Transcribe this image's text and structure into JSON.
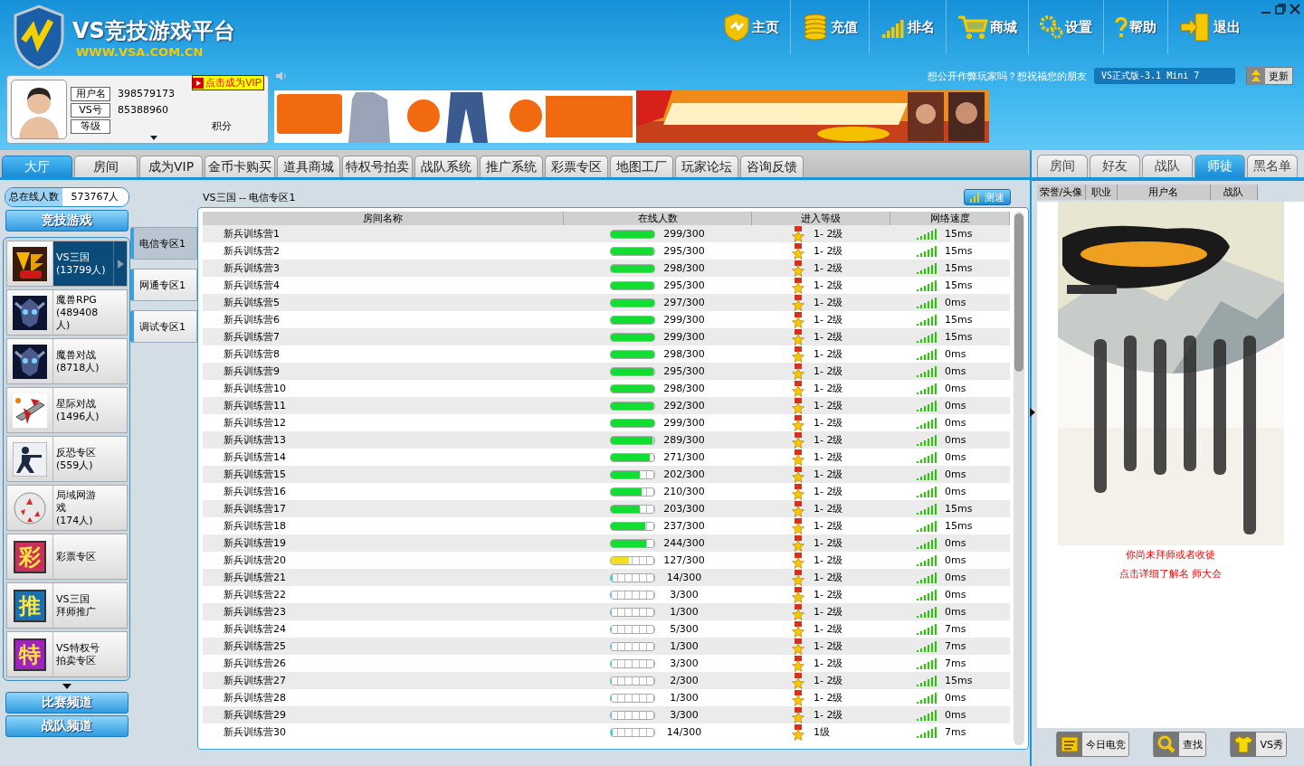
{
  "logo": {
    "title": "VS竞技游戏平台",
    "url": "WWW.VSA.COM.CN"
  },
  "nav": [
    {
      "kind": "home",
      "label": "主页"
    },
    {
      "kind": "coins",
      "label": "充值"
    },
    {
      "kind": "rank",
      "label": "排名"
    },
    {
      "kind": "cart",
      "label": "商城"
    },
    {
      "kind": "gear",
      "label": "设置"
    },
    {
      "kind": "help",
      "label": "帮助"
    },
    {
      "kind": "exit",
      "label": "退出"
    }
  ],
  "user": {
    "fields": [
      {
        "label": "用户名",
        "value": "398579173"
      },
      {
        "label": "VS号",
        "value": "85388960"
      },
      {
        "label": "等级"
      }
    ],
    "score_label": "积分",
    "vip_button": "点击成为VIP"
  },
  "notice": "想公开作弊玩家吗？想祝福您的朋友",
  "version": "VS正式版-3.1  Mini 7",
  "update_button": "更新",
  "main_tabs": [
    {
      "label": "大厅",
      "selected": true
    },
    {
      "label": "房间",
      "selected": false
    },
    {
      "label": "成为VIP",
      "selected": false
    },
    {
      "label": "金币卡购买",
      "selected": false
    },
    {
      "label": "道具商城",
      "selected": false
    },
    {
      "label": "特权号拍卖",
      "selected": false
    },
    {
      "label": "战队系统",
      "selected": false
    },
    {
      "label": "推广系统",
      "selected": false
    },
    {
      "label": "彩票专区",
      "selected": false
    },
    {
      "label": "地图工厂",
      "selected": false
    },
    {
      "label": "玩家论坛",
      "selected": false
    },
    {
      "label": "咨询反馈",
      "selected": false
    }
  ],
  "online": {
    "label": "总在线人数",
    "value": "573767人"
  },
  "games_header": "竞技游戏",
  "games": [
    {
      "kind": "vs",
      "lines": [
        "VS三国",
        "(13799人)"
      ],
      "selected": true
    },
    {
      "kind": "warcraft",
      "lines": [
        "魔兽RPG",
        "(489408",
        "人)"
      ],
      "selected": false
    },
    {
      "kind": "warcraft",
      "lines": [
        "魔兽对战",
        "(8718人)"
      ],
      "selected": false
    },
    {
      "kind": "starcraft",
      "lines": [
        "星际对战",
        "(1496人)"
      ],
      "selected": false
    },
    {
      "kind": "soldier",
      "lines": [
        "反恐专区",
        "(559人)"
      ],
      "selected": false
    },
    {
      "kind": "ball",
      "lines": [
        "局域网游",
        "戏",
        "(174人)"
      ],
      "selected": false
    },
    {
      "kind": "glyph",
      "icon_text": "彩",
      "color": "#c8305a",
      "lines": [
        "彩票专区"
      ],
      "selected": false
    },
    {
      "kind": "glyph",
      "icon_text": "推",
      "color": "#1a6fb0",
      "lines": [
        "VS三国",
        "拜师推广"
      ],
      "selected": false
    },
    {
      "kind": "glyph",
      "icon_text": "特",
      "color": "#a020c0",
      "lines": [
        "VS特权号",
        "拍卖专区"
      ],
      "selected": false
    }
  ],
  "channels": [
    "比赛频道",
    "战队频道"
  ],
  "zones": [
    {
      "label": "电信专区1",
      "selected": true
    },
    {
      "label": "网通专区1",
      "selected": false
    },
    {
      "label": "调试专区1",
      "selected": false
    }
  ],
  "breadcrumb": "VS三国 -- 电信专区1",
  "speed_test_button": "测速",
  "table": {
    "columns": [
      "房间名称",
      "在线人数",
      "进入等级",
      "网络速度"
    ],
    "rows": [
      {
        "name": "新兵训练营1",
        "count": "299/300",
        "level": 0.997,
        "range": "1- 2级",
        "speed": "15ms"
      },
      {
        "name": "新兵训练营2",
        "count": "295/300",
        "level": 0.983,
        "range": "1- 2级",
        "speed": "15ms"
      },
      {
        "name": "新兵训练营3",
        "count": "298/300",
        "level": 0.993,
        "range": "1- 2级",
        "speed": "15ms"
      },
      {
        "name": "新兵训练营4",
        "count": "295/300",
        "level": 0.983,
        "range": "1- 2级",
        "speed": "15ms"
      },
      {
        "name": "新兵训练营5",
        "count": "297/300",
        "level": 0.99,
        "range": "1- 2级",
        "speed": "0ms"
      },
      {
        "name": "新兵训练营6",
        "count": "299/300",
        "level": 0.997,
        "range": "1- 2级",
        "speed": "15ms"
      },
      {
        "name": "新兵训练营7",
        "count": "299/300",
        "level": 0.997,
        "range": "1- 2级",
        "speed": "15ms"
      },
      {
        "name": "新兵训练营8",
        "count": "298/300",
        "level": 0.993,
        "range": "1- 2级",
        "speed": "0ms"
      },
      {
        "name": "新兵训练营9",
        "count": "295/300",
        "level": 0.983,
        "range": "1- 2级",
        "speed": "0ms"
      },
      {
        "name": "新兵训练营10",
        "count": "298/300",
        "level": 0.993,
        "range": "1- 2级",
        "speed": "0ms"
      },
      {
        "name": "新兵训练营11",
        "count": "292/300",
        "level": 0.973,
        "range": "1- 2级",
        "speed": "0ms"
      },
      {
        "name": "新兵训练营12",
        "count": "299/300",
        "level": 0.997,
        "range": "1- 2级",
        "speed": "0ms"
      },
      {
        "name": "新兵训练营13",
        "count": "289/300",
        "level": 0.963,
        "range": "1- 2级",
        "speed": "0ms"
      },
      {
        "name": "新兵训练营14",
        "count": "271/300",
        "level": 0.903,
        "range": "1- 2级",
        "speed": "0ms"
      },
      {
        "name": "新兵训练营15",
        "count": "202/300",
        "level": 0.673,
        "range": "1- 2级",
        "speed": "0ms"
      },
      {
        "name": "新兵训练营16",
        "count": "210/300",
        "level": 0.7,
        "range": "1- 2级",
        "speed": "0ms"
      },
      {
        "name": "新兵训练营17",
        "count": "203/300",
        "level": 0.677,
        "range": "1- 2级",
        "speed": "15ms"
      },
      {
        "name": "新兵训练营18",
        "count": "237/300",
        "level": 0.79,
        "range": "1- 2级",
        "speed": "15ms"
      },
      {
        "name": "新兵训练营19",
        "count": "244/300",
        "level": 0.813,
        "range": "1- 2级",
        "speed": "0ms"
      },
      {
        "name": "新兵训练营20",
        "count": "127/300",
        "level": 0.423,
        "range": "1- 2级",
        "speed": "0ms"
      },
      {
        "name": "新兵训练营21",
        "count": "14/300",
        "level": 0.047,
        "range": "1- 2级",
        "speed": "0ms"
      },
      {
        "name": "新兵训练营22",
        "count": "3/300",
        "level": 0.01,
        "range": "1- 2级",
        "speed": "0ms"
      },
      {
        "name": "新兵训练营23",
        "count": "1/300",
        "level": 0.003,
        "range": "1- 2级",
        "speed": "0ms"
      },
      {
        "name": "新兵训练营24",
        "count": "5/300",
        "level": 0.017,
        "range": "1- 2级",
        "speed": "7ms"
      },
      {
        "name": "新兵训练营25",
        "count": "1/300",
        "level": 0.003,
        "range": "1- 2级",
        "speed": "7ms"
      },
      {
        "name": "新兵训练营26",
        "count": "3/300",
        "level": 0.01,
        "range": "1- 2级",
        "speed": "7ms"
      },
      {
        "name": "新兵训练营27",
        "count": "2/300",
        "level": 0.007,
        "range": "1- 2级",
        "speed": "15ms"
      },
      {
        "name": "新兵训练营28",
        "count": "1/300",
        "level": 0.003,
        "range": "1- 2级",
        "speed": "0ms"
      },
      {
        "name": "新兵训练营29",
        "count": "3/300",
        "level": 0.01,
        "range": "1- 2级",
        "speed": "0ms"
      },
      {
        "name": "新兵训练营30",
        "count": "14/300",
        "level": 0.047,
        "range": "1级",
        "speed": "7ms"
      }
    ]
  },
  "side_tabs": [
    {
      "label": "房间",
      "selected": false
    },
    {
      "label": "好友",
      "selected": false
    },
    {
      "label": "战队",
      "selected": false
    },
    {
      "label": "师徒",
      "selected": true
    },
    {
      "label": "黑名单",
      "selected": false
    }
  ],
  "side_columns": [
    "荣誉/头像",
    "职业",
    "用户名",
    "战队"
  ],
  "mentor_notice": [
    "你尚未拜师或者收徒",
    "点击详细了解名 师大会"
  ],
  "bottom_buttons": [
    {
      "kind": "news",
      "label": "今日电竞"
    },
    {
      "kind": "search",
      "label": "查找"
    },
    {
      "kind": "shirt",
      "label": "VS秀"
    }
  ]
}
